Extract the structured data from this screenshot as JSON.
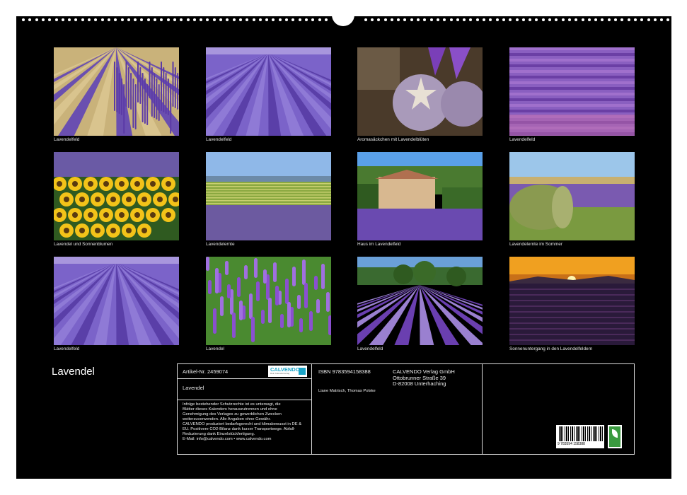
{
  "photos": [
    {
      "caption": "Lavendelfeld",
      "icon": "lavender-closeup"
    },
    {
      "caption": "Lavendelfeld",
      "icon": "lavender-rows"
    },
    {
      "caption": "Aromasäckchen mit Lavendelblüten",
      "icon": "lavender-sachets"
    },
    {
      "caption": "Lavendelfeld",
      "icon": "lavender-field"
    },
    {
      "caption": "Lavendel und Sonnenblumen",
      "icon": "sunflowers"
    },
    {
      "caption": "Lavendelernte",
      "icon": "harvest-field"
    },
    {
      "caption": "Haus im Lavendelfeld",
      "icon": "farmhouse"
    },
    {
      "caption": "Lavendelernte im Sommer",
      "icon": "hay-bale"
    },
    {
      "caption": "Lavendelfeld",
      "icon": "lavender-rows"
    },
    {
      "caption": "Lavendel",
      "icon": "lavender-flowers"
    },
    {
      "caption": "Lavendelfeld",
      "icon": "lavender-trees"
    },
    {
      "caption": "Sonnenuntergang in den Lavendelfeldern",
      "icon": "sunset"
    }
  ],
  "cover_title": "Lavendel",
  "info": {
    "article": "Artikel-Nr. 2459074",
    "logo_text": "CALVENDO",
    "logo_sub": "Dein Kalenderverlag",
    "product_title": "Lavendel",
    "legal": [
      "Infolge bestehender Schutzrechte ist es untersagt, die",
      "Blätter dieses Kalenders herauszutrennen und ohne",
      "Genehmigung des Verlages zu gewerblichen Zwecken",
      "weiterzuverwenden. Alle Angaben ohne Gewähr.",
      "CALVENDO produziert bedarfsgerecht und klimabewusst in DE &",
      "EU. Positivere CO2-Bilanz dank kurzer Transportwege. Abfall-",
      "Reduzierung dank Einzelstückfertigung.",
      "E-Mail: info@calvendo.com • www.calvendo.com"
    ],
    "isbn": "ISBN 9783594158388",
    "authors": "Liane Matrisch, Thomas Polske",
    "publisher": [
      "CALVENDO Verlag GmbH",
      "Ottobrunner Straße 39",
      "D-82008 Unterhaching"
    ],
    "barcode_digits": "9  783594  158388"
  }
}
